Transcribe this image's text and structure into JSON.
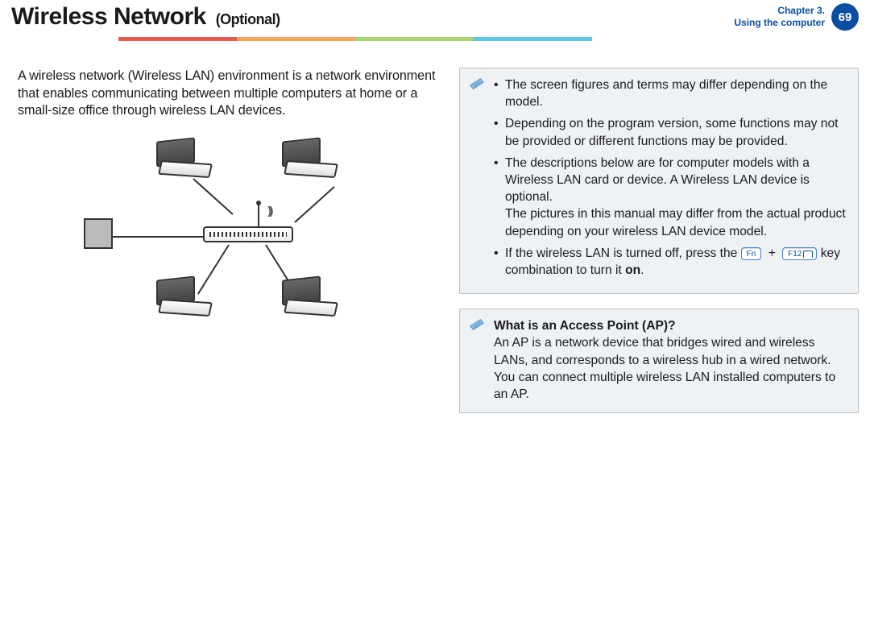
{
  "header": {
    "title_main": "Wireless Network",
    "title_sub": "(Optional)",
    "chapter_line1": "Chapter 3.",
    "chapter_line2": "Using the computer",
    "page_number": "69"
  },
  "left": {
    "intro": "A wireless network (Wireless LAN) environment is a network environment that enables communicating between multiple computers at home or a small-size office through wireless LAN devices."
  },
  "notes": {
    "bullet1": "The screen figures and terms may differ depending on the model.",
    "bullet2": "Depending on the program version, some functions may not be provided or different functions may be provided.",
    "bullet3a": "The descriptions below are for computer models with a Wireless LAN card or device. A Wireless LAN device is optional.",
    "bullet3b": "The pictures in this manual may differ from the actual product depending on your wireless LAN device model.",
    "bullet4_prefix": "If the wireless LAN is turned off, press the ",
    "key_fn": "Fn",
    "plus": "+",
    "key_f12": "F12",
    "bullet4_mid": " key combination to turn it ",
    "bullet4_on": "on",
    "bullet4_end": "."
  },
  "ap": {
    "title": "What is an Access Point (AP)?",
    "body": "An AP is a network device that bridges wired and wireless LANs, and corresponds to a wireless hub in a wired network. You can connect multiple wireless LAN installed computers to an AP."
  }
}
